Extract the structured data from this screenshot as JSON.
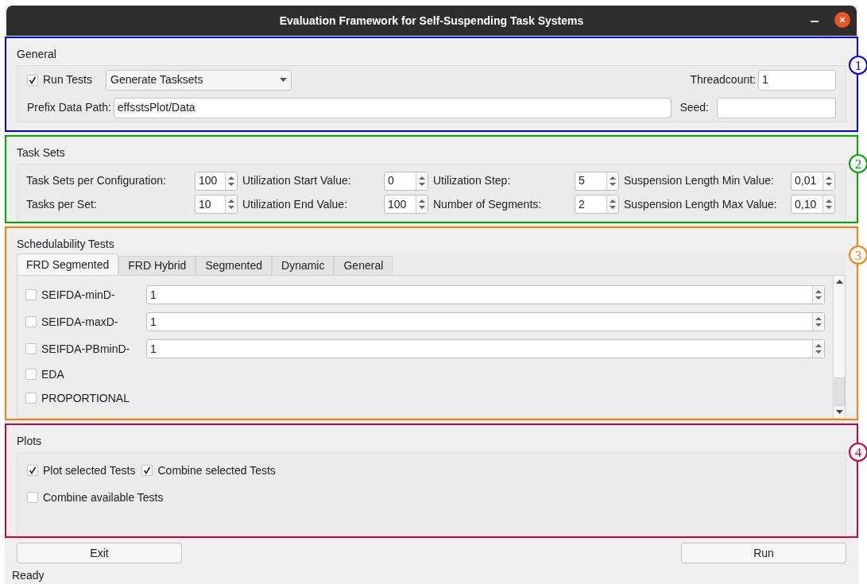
{
  "window": {
    "title": "Evaluation Framework for Self-Suspending Task Systems"
  },
  "general": {
    "annotation": {
      "label": "1",
      "color": "#0000ee"
    },
    "title": "General",
    "run_tests": {
      "label": "Run Tests",
      "checked": true
    },
    "mode": {
      "value": "Generate Tasksets"
    },
    "threadcount": {
      "label": "Threadcount:",
      "value": "1"
    },
    "prefix": {
      "label": "Prefix Data Path:",
      "value": "effsstsPlot/Data"
    },
    "seed": {
      "label": "Seed:"
    }
  },
  "task_sets": {
    "annotation": {
      "label": "2",
      "color": "#00aa00"
    },
    "title": "Task Sets",
    "fields": [
      {
        "label": "Task Sets per Configuration:",
        "value": "100"
      },
      {
        "label": "Utilization Start Value:",
        "value": "0"
      },
      {
        "label": "Utilization Step:",
        "value": "5"
      },
      {
        "label": "Suspension Length Min Value:",
        "value": "0,01"
      },
      {
        "label": "Tasks per Set:",
        "value": "10"
      },
      {
        "label": "Utilization End Value:",
        "value": "100"
      },
      {
        "label": "Number of Segments:",
        "value": "2"
      },
      {
        "label": "Suspension Length Max Value:",
        "value": "0,10"
      }
    ]
  },
  "schedulability_tests": {
    "annotation": {
      "label": "3",
      "color": "#ff8000"
    },
    "title": "Schedulability Tests",
    "tabs": [
      {
        "label": "FRD Segmented",
        "selected": true
      },
      {
        "label": "FRD Hybrid",
        "selected": false
      },
      {
        "label": "Segmented",
        "selected": false
      },
      {
        "label": "Dynamic",
        "selected": false
      },
      {
        "label": "General",
        "selected": false
      }
    ],
    "tests": [
      {
        "kind": "spin",
        "label": "SEIFDA-minD-",
        "checked": false,
        "value": "1"
      },
      {
        "kind": "spin",
        "label": "SEIFDA-maxD-",
        "checked": false,
        "value": "1"
      },
      {
        "kind": "spin",
        "label": "SEIFDA-PBminD-",
        "checked": false,
        "value": "1"
      },
      {
        "kind": "plain",
        "label": "EDA",
        "checked": false
      },
      {
        "kind": "plain",
        "label": "PROPORTIONAL",
        "checked": false
      }
    ]
  },
  "plots": {
    "annotation": {
      "label": "4",
      "color": "#cc0044"
    },
    "title": "Plots",
    "options": [
      {
        "label": "Plot selected Tests",
        "checked": true
      },
      {
        "label": "Combine selected Tests",
        "checked": true
      },
      {
        "label": "Combine available Tests",
        "checked": false
      }
    ]
  },
  "buttons": [
    {
      "label": "Exit"
    },
    {
      "label": "Run"
    }
  ],
  "status_bar": {
    "text": "Ready"
  }
}
